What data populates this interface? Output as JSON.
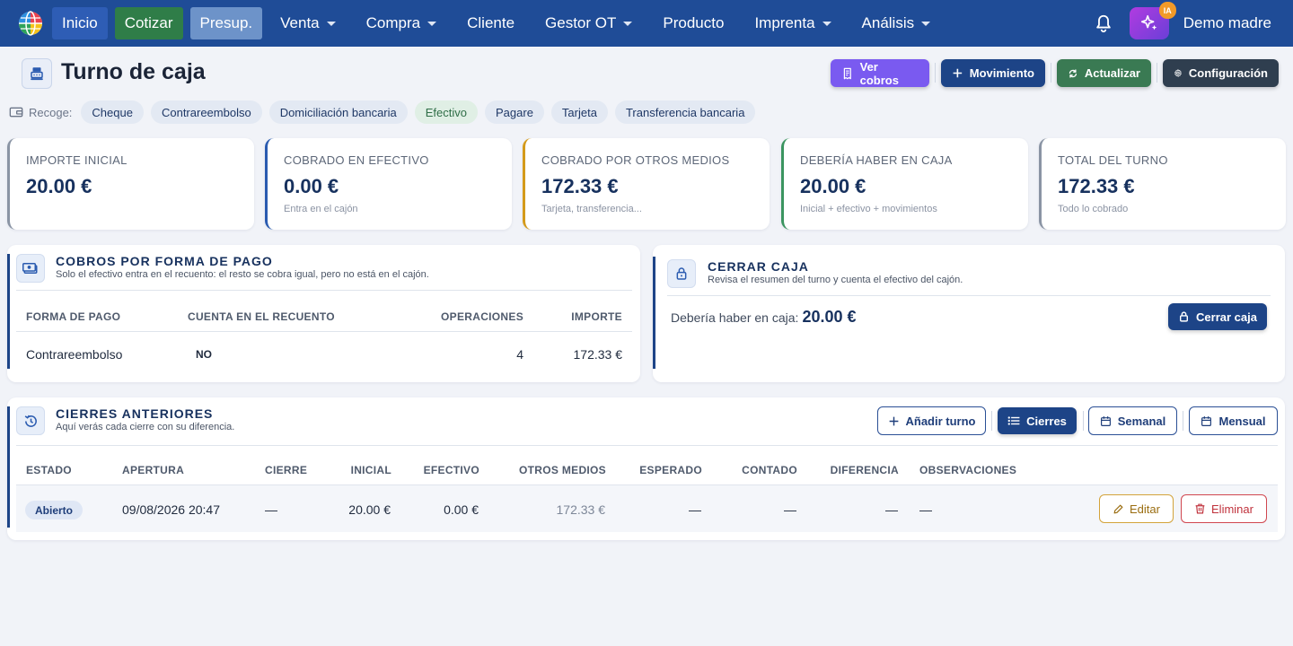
{
  "nav": {
    "items": [
      {
        "label": "Inicio",
        "dropdown": false
      },
      {
        "label": "Cotizar",
        "dropdown": false
      },
      {
        "label": "Presup.",
        "dropdown": false
      },
      {
        "label": "Venta",
        "dropdown": true
      },
      {
        "label": "Compra",
        "dropdown": true
      },
      {
        "label": "Cliente",
        "dropdown": false
      },
      {
        "label": "Gestor OT",
        "dropdown": true
      },
      {
        "label": "Producto",
        "dropdown": false
      },
      {
        "label": "Imprenta",
        "dropdown": true
      },
      {
        "label": "Análisis",
        "dropdown": true
      }
    ],
    "ai_badge": "IA",
    "user_name": "Demo madre"
  },
  "header": {
    "title": "Turno de caja",
    "buttons": {
      "ver_cobros": "Ver cobros",
      "movimiento": "Movimiento",
      "actualizar": "Actualizar",
      "configuracion": "Configuración"
    }
  },
  "payment_methods": {
    "label": "Recoge:",
    "items": [
      "Cheque",
      "Contrareembolso",
      "Domiciliación bancaria",
      "Efectivo",
      "Pagare",
      "Tarjeta",
      "Transferencia bancaria"
    ],
    "active": "Efectivo"
  },
  "kpis": [
    {
      "label": "IMPORTE INICIAL",
      "value": "20.00 €",
      "sub": ""
    },
    {
      "label": "COBRADO EN EFECTIVO",
      "value": "0.00 €",
      "sub": "Entra en el cajón"
    },
    {
      "label": "COBRADO POR OTROS MEDIOS",
      "value": "172.33 €",
      "sub": "Tarjeta, transferencia..."
    },
    {
      "label": "DEBERÍA HABER EN CAJA",
      "value": "20.00 €",
      "sub": "Inicial + efectivo + movimientos"
    },
    {
      "label": "TOTAL DEL TURNO",
      "value": "172.33 €",
      "sub": "Todo lo cobrado"
    }
  ],
  "cobros": {
    "title": "COBROS POR FORMA DE PAGO",
    "subtitle": "Solo el efectivo entra en el recuento: el resto se cobra igual, pero no está en el cajón.",
    "columns": [
      "FORMA DE PAGO",
      "CUENTA EN EL RECUENTO",
      "OPERACIONES",
      "IMPORTE"
    ],
    "rows": [
      {
        "forma": "Contrareembolso",
        "cuenta": "NO",
        "operaciones": "4",
        "importe": "172.33 €"
      }
    ]
  },
  "cerrar": {
    "title": "CERRAR CAJA",
    "subtitle": "Revisa el resumen del turno y cuenta el efectivo del cajón.",
    "expected_label": "Debería haber en caja:",
    "expected_value": "20.00 €",
    "button": "Cerrar caja"
  },
  "cierres": {
    "title": "CIERRES ANTERIORES",
    "subtitle": "Aquí verás cada cierre con su diferencia.",
    "buttons": {
      "add": "Añadir turno",
      "cierres": "Cierres",
      "semanal": "Semanal",
      "mensual": "Mensual"
    },
    "columns": [
      "ESTADO",
      "APERTURA",
      "CIERRE",
      "INICIAL",
      "EFECTIVO",
      "OTROS MEDIOS",
      "ESPERADO",
      "CONTADO",
      "DIFERENCIA",
      "OBSERVACIONES"
    ],
    "rows": [
      {
        "estado": "Abierto",
        "apertura": "09/08/2026 20:47",
        "cierre": "—",
        "inicial": "20.00 €",
        "efectivo": "0.00 €",
        "otros": "172.33 €",
        "esperado": "—",
        "contado": "—",
        "diferencia": "—",
        "observaciones": "—",
        "edit": "Editar",
        "delete": "Eliminar"
      }
    ]
  },
  "colors": {
    "navbar": "#1f4c97",
    "accent": "#1d4487",
    "cotizar": "#2f7d48",
    "ver_cobros": "#7a5af0",
    "actualizar": "#3a7a53",
    "configuracion": "#2f3e4f"
  }
}
